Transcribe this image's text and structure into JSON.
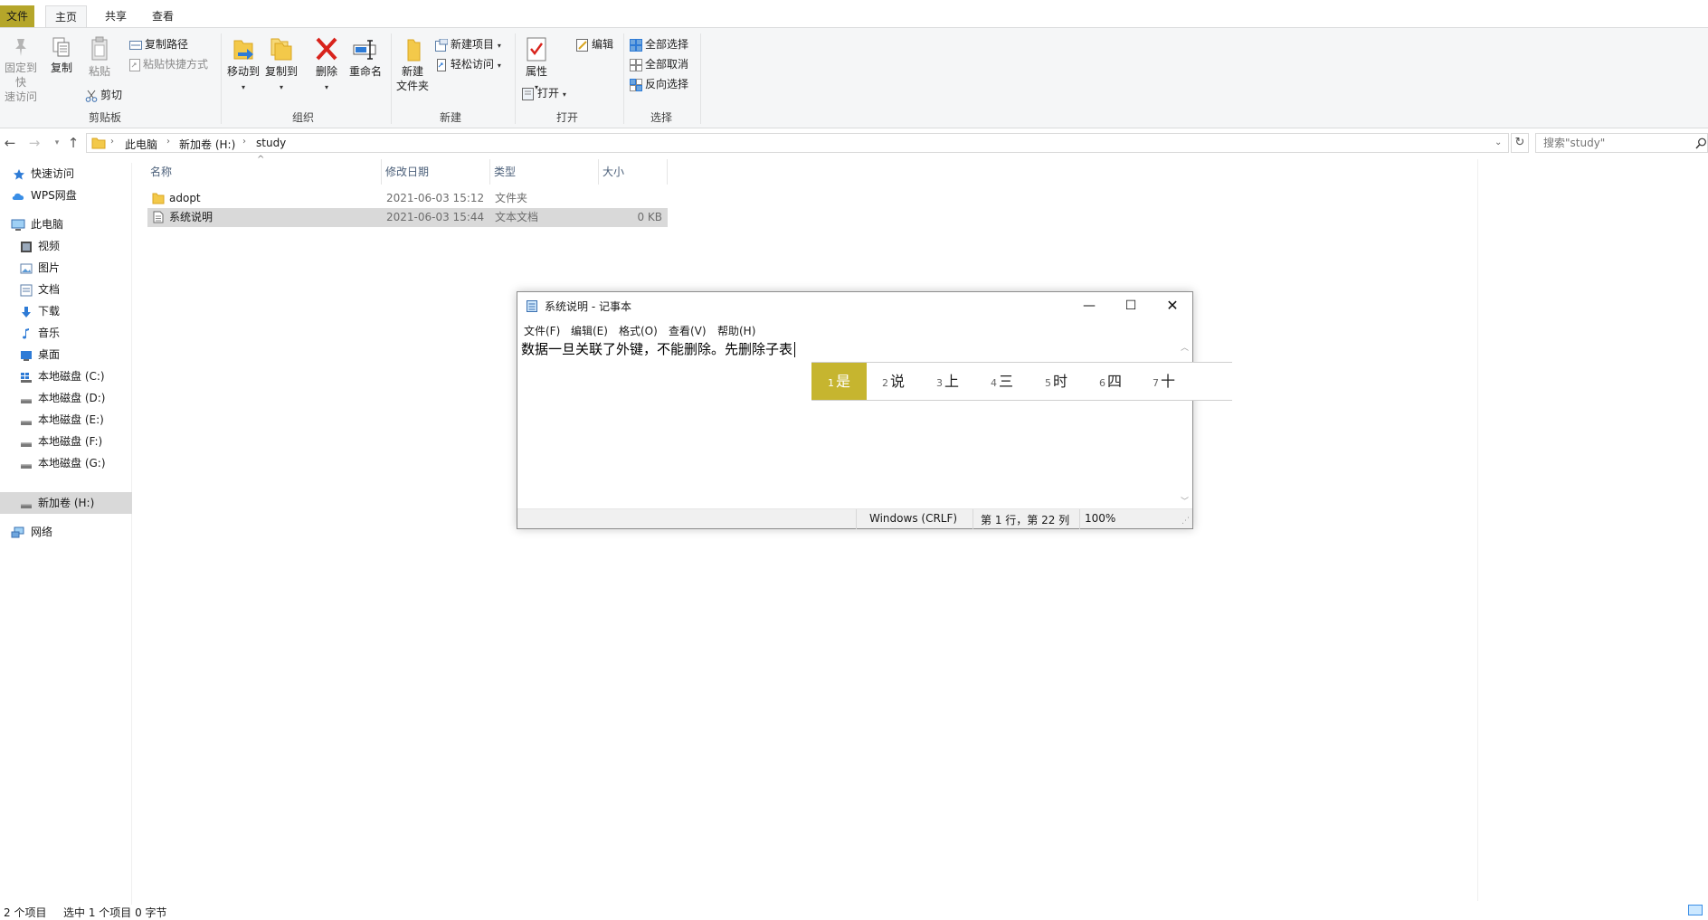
{
  "ribbon": {
    "tabs": [
      "文件",
      "主页",
      "共享",
      "查看"
    ],
    "clipboard": {
      "pin_label": [
        "固定到快",
        "速访问"
      ],
      "copy_label": "复制",
      "paste_label": "粘贴",
      "copy_path_label": "复制路径",
      "paste_shortcut_label": "粘贴快捷方式",
      "cut_label": "剪切",
      "group_label": "剪贴板"
    },
    "organize": {
      "move_to_label": "移动到",
      "copy_to_label": "复制到",
      "delete_label": "删除",
      "rename_label": "重命名",
      "group_label": "组织"
    },
    "new": {
      "new_folder_label": [
        "新建",
        "文件夹"
      ],
      "new_item_label": "新建项目",
      "easy_access_label": "轻松访问",
      "group_label": "新建"
    },
    "open": {
      "properties_label": "属性",
      "open_label": "打开",
      "edit_label": "编辑",
      "group_label": "打开"
    },
    "select": {
      "select_all_label": "全部选择",
      "select_none_label": "全部取消",
      "invert_label": "反向选择",
      "group_label": "选择"
    }
  },
  "address": {
    "crumbs": [
      "此电脑",
      "新加卷 (H:)",
      "study"
    ],
    "search_placeholder": "搜索\"study\""
  },
  "navpane": {
    "items": [
      {
        "label": "快速访问",
        "icon": "star-icon"
      },
      {
        "label": "WPS网盘",
        "icon": "cloud-icon"
      },
      {
        "label": "此电脑",
        "icon": "computer-icon"
      },
      {
        "label": "视频",
        "icon": "video-icon"
      },
      {
        "label": "图片",
        "icon": "picture-icon"
      },
      {
        "label": "文档",
        "icon": "document-icon"
      },
      {
        "label": "下载",
        "icon": "download-icon"
      },
      {
        "label": "音乐",
        "icon": "music-icon"
      },
      {
        "label": "桌面",
        "icon": "desktop-icon"
      },
      {
        "label": "本地磁盘 (C:)",
        "icon": "drive-icon"
      },
      {
        "label": "本地磁盘 (D:)",
        "icon": "drive-icon"
      },
      {
        "label": "本地磁盘 (E:)",
        "icon": "drive-icon"
      },
      {
        "label": "本地磁盘 (F:)",
        "icon": "drive-icon"
      },
      {
        "label": "本地磁盘 (G:)",
        "icon": "drive-icon"
      },
      {
        "label": "新加卷 (H:)",
        "icon": "drive-icon"
      },
      {
        "label": "网络",
        "icon": "network-icon"
      }
    ]
  },
  "filelist": {
    "columns": [
      "名称",
      "修改日期",
      "类型",
      "大小"
    ],
    "rows": [
      {
        "name": "adopt",
        "date": "2021-06-03 15:12",
        "type": "文件夹",
        "size": ""
      },
      {
        "name": "系统说明",
        "date": "2021-06-03 15:44",
        "type": "文本文档",
        "size": "0 KB"
      }
    ]
  },
  "notepad": {
    "title": "系统说明 - 记事本",
    "menus": [
      "文件(F)",
      "编辑(E)",
      "格式(O)",
      "查看(V)",
      "帮助(H)"
    ],
    "content": "数据一旦关联了外键，不能删除。先删除子表",
    "status": {
      "encoding": "Windows (CRLF)",
      "position": "第 1 行，第 22 列",
      "zoom": "100%"
    }
  },
  "ime": {
    "candidates": [
      {
        "num": "1",
        "text": "是"
      },
      {
        "num": "2",
        "text": "说"
      },
      {
        "num": "3",
        "text": "上"
      },
      {
        "num": "4",
        "text": "三"
      },
      {
        "num": "5",
        "text": "时"
      },
      {
        "num": "6",
        "text": "四"
      },
      {
        "num": "7",
        "text": "十"
      }
    ]
  },
  "statusbar": {
    "item_count": "2 个项目",
    "selected": "选中 1 个项目  0 字节"
  },
  "colors": {
    "accent": "#c6b52f",
    "selection": "#d9d9d9",
    "ribbon_bg": "#f5f6f7"
  }
}
